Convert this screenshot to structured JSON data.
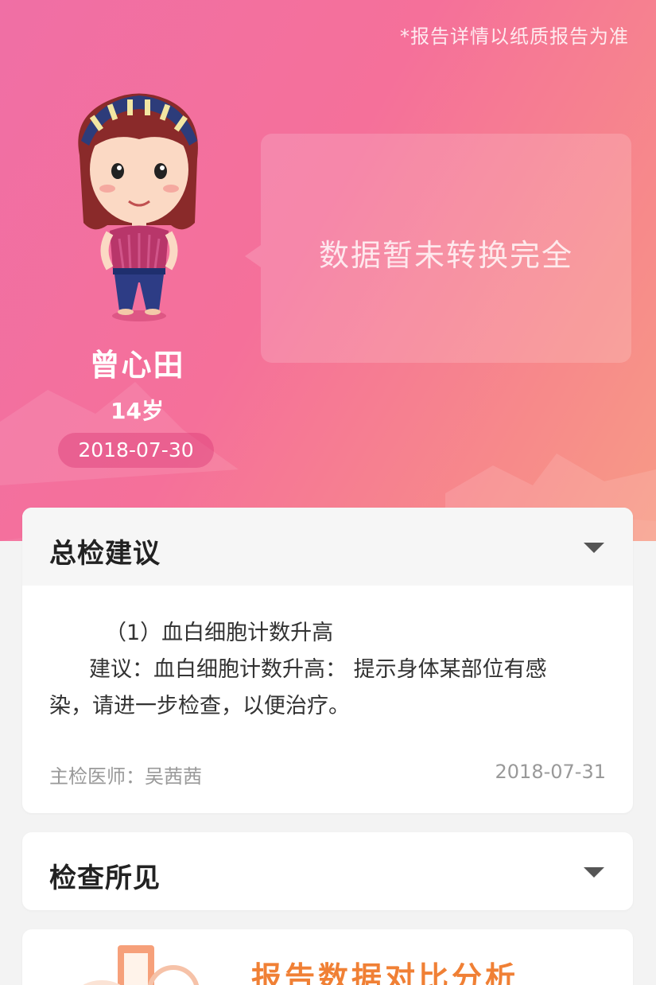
{
  "header": {
    "notice": "*报告详情以纸质报告为准",
    "status_message": "数据暂未转换完全",
    "colors": {
      "gradient_start": "#f06fa5",
      "gradient_end": "#f79b86",
      "accent": "#f08035"
    }
  },
  "profile": {
    "name": "曾心田",
    "age": "14岁",
    "date": "2018-07-30",
    "avatar_icon": "girl-avatar-icon"
  },
  "summary_card": {
    "title": "总检建议",
    "item_title": "（1）血白细胞计数升高",
    "item_advice_line1": "建议：血白细胞计数升高：  提示身体某部位有感",
    "item_advice_line2": "染，请进一步检查，以便治疗。",
    "doctor": "主检医师：吴茜茜",
    "date": "2018-07-31",
    "toggle_icon": "chevron-down-icon"
  },
  "findings_card": {
    "title": "检查所见",
    "toggle_icon": "chevron-down-icon"
  },
  "promo_card": {
    "title": "报告数据对比分析",
    "illustration_icon": "report-analysis-icon"
  }
}
